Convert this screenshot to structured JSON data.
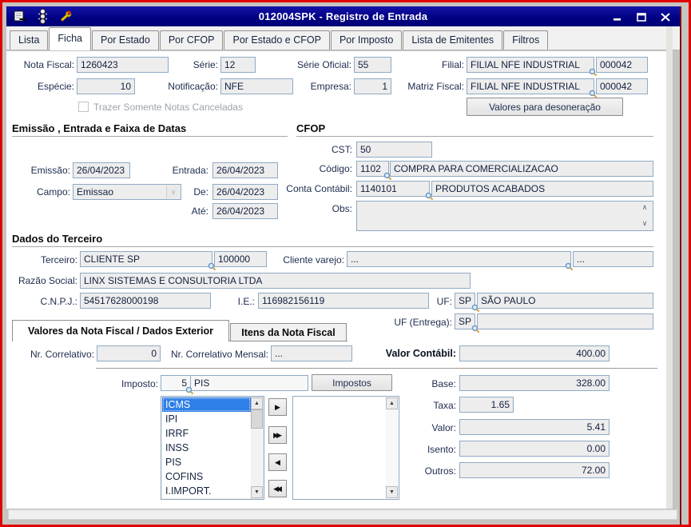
{
  "window": {
    "title": "012004SPK - Registro de Entrada"
  },
  "icons": {
    "arrow_right": "▶",
    "arrow_right_double": "▶▶",
    "arrow_left": "◀",
    "arrow_left_double": "◀◀",
    "arrow_up": "▲",
    "arrow_down": "▼",
    "chevron_up": "∧",
    "chevron_down": "∨"
  },
  "tabs": {
    "items": [
      "Lista",
      "Ficha",
      "Por Estado",
      "Por CFOP",
      "Por Estado e CFOP",
      "Por Imposto",
      "Lista de Emitentes",
      "Filtros"
    ],
    "active": "Ficha"
  },
  "header": {
    "nota_fiscal_label": "Nota Fiscal:",
    "nota_fiscal": "1260423",
    "serie_label": "Série:",
    "serie": "12",
    "serie_oficial_label": "Série Oficial:",
    "serie_oficial": "55",
    "filial_label": "Filial:",
    "filial_name": "FILIAL NFE INDUSTRIAL",
    "filial_code": "000042",
    "especie_label": "Espécie:",
    "especie": "10",
    "notificacao_label": "Notificação:",
    "notificacao": "NFE",
    "empresa_label": "Empresa:",
    "empresa": "1",
    "matriz_label": "Matriz Fiscal:",
    "matriz_name": "FILIAL NFE INDUSTRIAL",
    "matriz_code": "000042",
    "canceladas_checkbox_label": "Trazer Somente Notas Canceladas",
    "desoneracao_button": "Valores para desoneração"
  },
  "datas": {
    "title": "Emissão , Entrada e Faixa de Datas",
    "emissao_label": "Emissão:",
    "emissao": "26/04/2023",
    "entrada_label": "Entrada:",
    "entrada": "26/04/2023",
    "campo_label": "Campo:",
    "campo": "Emissao",
    "de_label": "De:",
    "de": "26/04/2023",
    "ate_label": "Até:",
    "ate": "26/04/2023"
  },
  "cfop": {
    "title": "CFOP",
    "cst_label": "CST:",
    "cst": "50",
    "codigo_label": "Código:",
    "codigo": "1102",
    "codigo_desc": "COMPRA PARA COMERCIALIZACAO",
    "conta_label": "Conta Contábil:",
    "conta": "1140101",
    "conta_desc": "PRODUTOS ACABADOS",
    "obs_label": "Obs:",
    "obs": ""
  },
  "terceiro": {
    "title": "Dados do Terceiro",
    "terceiro_label": "Terceiro:",
    "terceiro_name": "CLIENTE SP",
    "terceiro_code": "100000",
    "cliente_varejo_label": "Cliente varejo:",
    "cliente_varejo": "...",
    "cliente_varejo2": "...",
    "razao_label": "Razão Social:",
    "razao": "LINX SISTEMAS E CONSULTORIA LTDA",
    "cnpj_label": "C.N.P.J.:",
    "cnpj": "54517628000198",
    "ie_label": "I.E.:",
    "ie": "116982156119",
    "uf_label": "UF:",
    "uf": "SP",
    "uf_desc": "SÃO PAULO",
    "uf_entrega_label": "UF (Entrega):",
    "uf_entrega": "SP",
    "uf_entrega_desc": ""
  },
  "valores": {
    "tab_valores": "Valores da Nota Fiscal / Dados Exterior",
    "tab_itens": "Itens da Nota Fiscal",
    "nr_label": "Nr. Correlativo:",
    "nr": "0",
    "nr_mensal_label": "Nr. Correlativo Mensal:",
    "nr_mensal": "...",
    "valor_contabil_label": "Valor Contábil:",
    "valor_contabil": "400.00",
    "imposto_label": "Imposto:",
    "imposto_code": "5",
    "imposto_desc": "PIS",
    "impostos_button": "Impostos",
    "impostos": [
      "ICMS",
      "IPI",
      "IRRF",
      "INSS",
      "PIS",
      "COFINS",
      "I.IMPORT."
    ],
    "selected_imposto": "ICMS",
    "base_label": "Base:",
    "base": "328.00",
    "taxa_label": "Taxa:",
    "taxa": "1.65",
    "valor_label": "Valor:",
    "valor": "5.41",
    "isento_label": "Isento:",
    "isento": "0.00",
    "outros_label": "Outros:",
    "outros": "72.00"
  },
  "colors": {
    "titlebar": "#000080",
    "annotation_border": "#e00000",
    "selection": "#2e7fe8"
  }
}
